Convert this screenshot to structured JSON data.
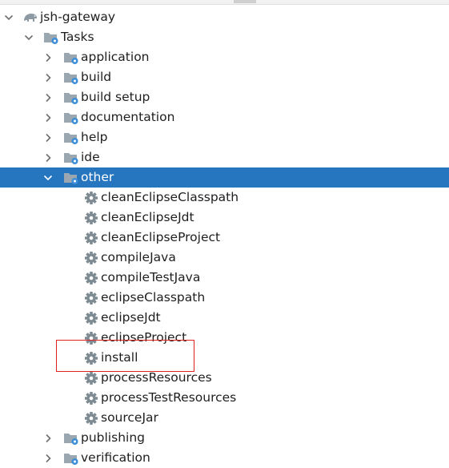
{
  "tree": {
    "root": {
      "label": "jsh-gateway",
      "icon": "gradle-elephant-icon"
    },
    "tasks": {
      "label": "Tasks",
      "icon": "folder-gear-icon"
    },
    "groups_before": [
      {
        "label": "application",
        "name": "application"
      },
      {
        "label": "build",
        "name": "build"
      },
      {
        "label": "build setup",
        "name": "build-setup"
      },
      {
        "label": "documentation",
        "name": "documentation"
      },
      {
        "label": "help",
        "name": "help"
      },
      {
        "label": "ide",
        "name": "ide"
      }
    ],
    "selected_group": {
      "label": "other",
      "name": "other"
    },
    "other_tasks": [
      {
        "label": "cleanEclipseClasspath",
        "name": "cleanEclipseClasspath"
      },
      {
        "label": "cleanEclipseJdt",
        "name": "cleanEclipseJdt"
      },
      {
        "label": "cleanEclipseProject",
        "name": "cleanEclipseProject"
      },
      {
        "label": "compileJava",
        "name": "compileJava"
      },
      {
        "label": "compileTestJava",
        "name": "compileTestJava"
      },
      {
        "label": "eclipseClasspath",
        "name": "eclipseClasspath"
      },
      {
        "label": "eclipseJdt",
        "name": "eclipseJdt"
      },
      {
        "label": "eclipseProject",
        "name": "eclipseProject"
      },
      {
        "label": "install",
        "name": "install"
      },
      {
        "label": "processResources",
        "name": "processResources"
      },
      {
        "label": "processTestResources",
        "name": "processTestResources"
      },
      {
        "label": "sourceJar",
        "name": "sourceJar"
      }
    ],
    "groups_after": [
      {
        "label": "publishing",
        "name": "publishing"
      },
      {
        "label": "verification",
        "name": "verification"
      }
    ]
  },
  "colors": {
    "selection": "#2675bf",
    "highlight_box": "#e02222",
    "folder": "#9aa7b0",
    "gear_badge": "#3d8ed8",
    "task_gear": "#7f8b93"
  }
}
